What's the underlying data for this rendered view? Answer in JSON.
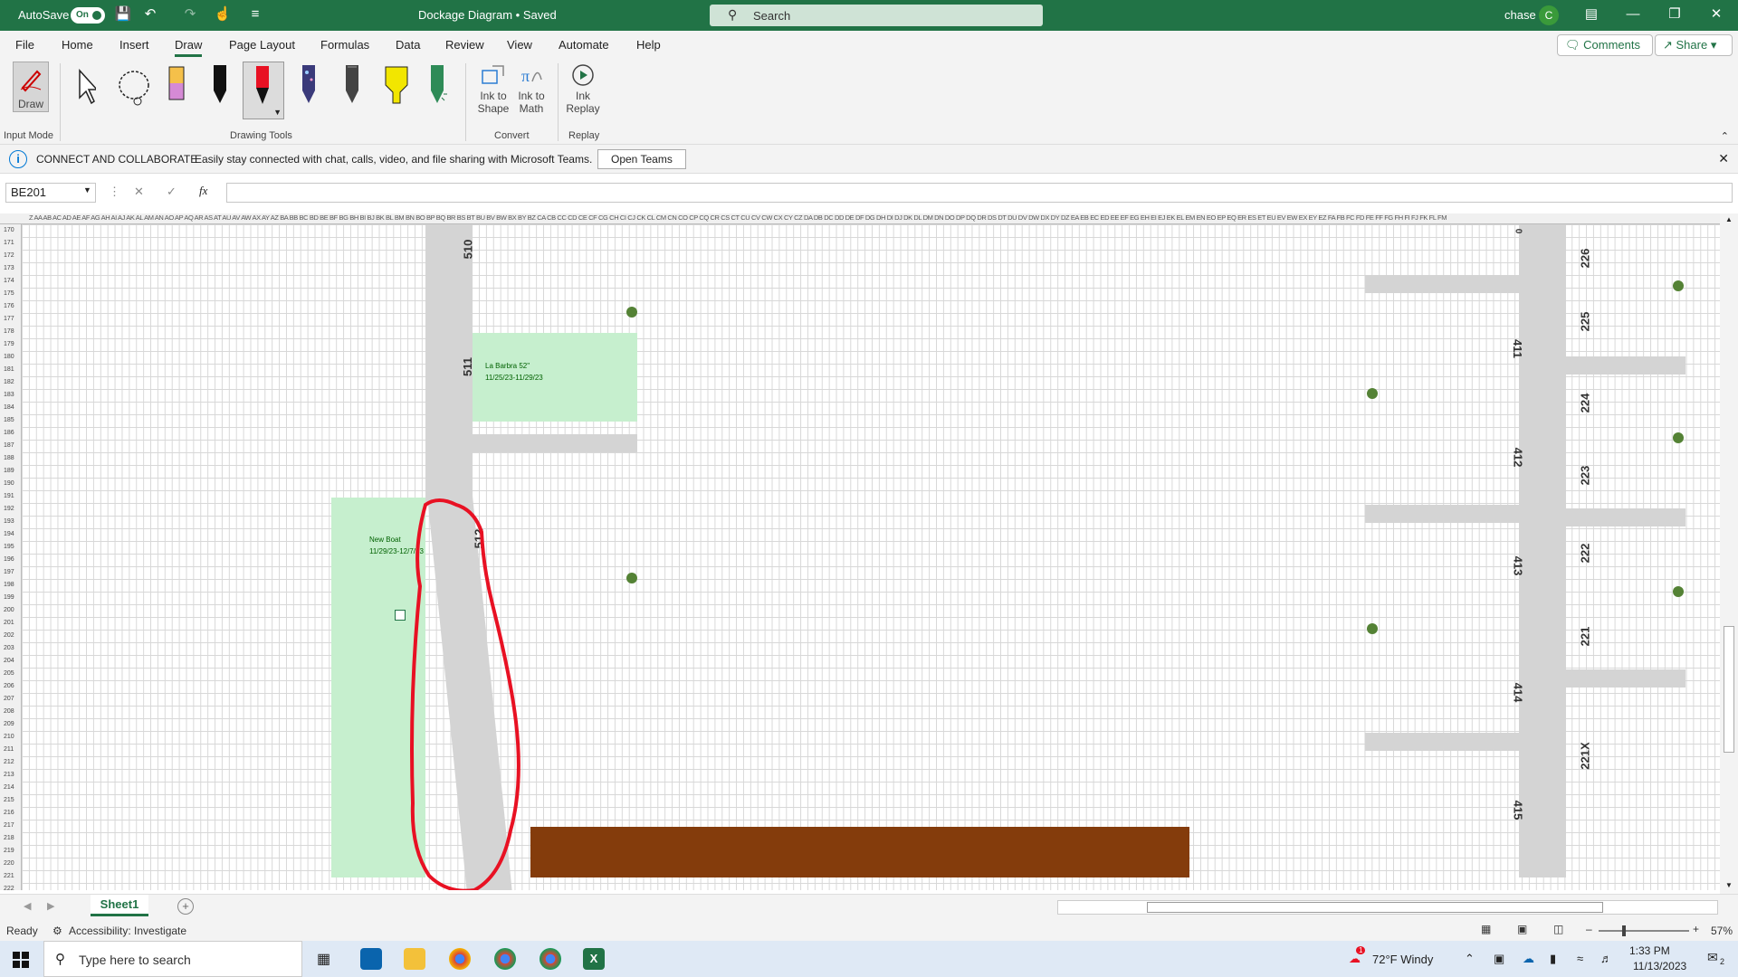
{
  "titlebar": {
    "autosave_label": "AutoSave",
    "autosave_state": "On",
    "doc_title": "Dockage Diagram • Saved",
    "search_placeholder": "Search",
    "user_name": "chase",
    "user_initial": "C"
  },
  "menu": {
    "items": [
      "File",
      "Home",
      "Insert",
      "Draw",
      "Page Layout",
      "Formulas",
      "Data",
      "Review",
      "View",
      "Automate",
      "Help"
    ],
    "active": "Draw",
    "comments_label": "Comments",
    "share_label": "Share"
  },
  "ribbon": {
    "draw_label": "Draw",
    "input_mode_label": "Input Mode",
    "drawing_tools_label": "Drawing Tools",
    "ink_to_shape": [
      "Ink to",
      "Shape"
    ],
    "ink_to_math": [
      "Ink to",
      "Math"
    ],
    "convert_label": "Convert",
    "ink_replay": [
      "Ink",
      "Replay"
    ],
    "replay_label": "Replay"
  },
  "infobar": {
    "title": "CONNECT AND COLLABORATE",
    "message": "Easily stay connected with chat, calls, video, and file sharing with Microsoft Teams.",
    "button": "Open Teams"
  },
  "formula_bar": {
    "name_box": "BE201",
    "fx": "fx",
    "value": ""
  },
  "grid": {
    "column_header_text": "Z AA AB AC AD AE AF AG AH AI AJ AK AL AM AN AO AP AQ AR AS AT AU AV AW AX AY AZ BA BB BC BD BE BF BG BH BI BJ BK BL BM BN BO BP BQ BR BS BT BU BV BW BX BY BZ CA CB CC CD CE CF CG CH CI CJ CK CL CM CN CO CP CQ CR CS CT CU CV CW CX CY CZ DA DB DC DD DE DF DG DH DI DJ DK DL DM DN DO DP DQ DR DS DT DU DV DW DX DY DZ EA EB EC ED EE EF EG EH EI EJ EK EL EM EN EO EP EQ ER ES ET EU EV EW EX EY EZ FA FB FC FD FE FF FG FH FI FJ FK FL FM",
    "rows": [
      "170",
      "171",
      "172",
      "173",
      "174",
      "175",
      "176",
      "177",
      "178",
      "179",
      "180",
      "181",
      "182",
      "183",
      "184",
      "185",
      "186",
      "187",
      "188",
      "189",
      "190",
      "191",
      "192",
      "193",
      "194",
      "195",
      "196",
      "197",
      "198",
      "199",
      "200",
      "201",
      "202",
      "203",
      "204",
      "205",
      "206",
      "207",
      "208",
      "209",
      "210",
      "211",
      "212",
      "213",
      "214",
      "215",
      "216",
      "217",
      "218",
      "219",
      "220",
      "221",
      "222"
    ],
    "slip_labels": [
      "510",
      "511",
      "512",
      "411",
      "412",
      "413",
      "414",
      "415",
      "226",
      "225",
      "224",
      "223",
      "222",
      "221",
      "221X",
      "0"
    ],
    "note_labarbra": [
      "La Barbra 52\"",
      "11/25/23-11/29/23"
    ],
    "note_newboat": [
      "New Boat",
      "11/29/23-12/7/23"
    ]
  },
  "sheets": {
    "tabs": [
      "Sheet1"
    ],
    "active": "Sheet1"
  },
  "status": {
    "ready": "Ready",
    "accessibility": "Accessibility: Investigate",
    "zoom": "57%"
  },
  "taskbar": {
    "search_placeholder": "Type here to search",
    "weather": "72°F  Windy",
    "time": "1:33 PM",
    "date": "11/13/2023",
    "notif_count": "2",
    "weather_badge": "1"
  },
  "colors": {
    "excel_green": "#217346",
    "dock_gray": "#d4d4d4",
    "slip_green": "#c6efce",
    "piling_green": "#548235",
    "ink_red": "#e81123",
    "brown_dock": "#843c0c"
  }
}
